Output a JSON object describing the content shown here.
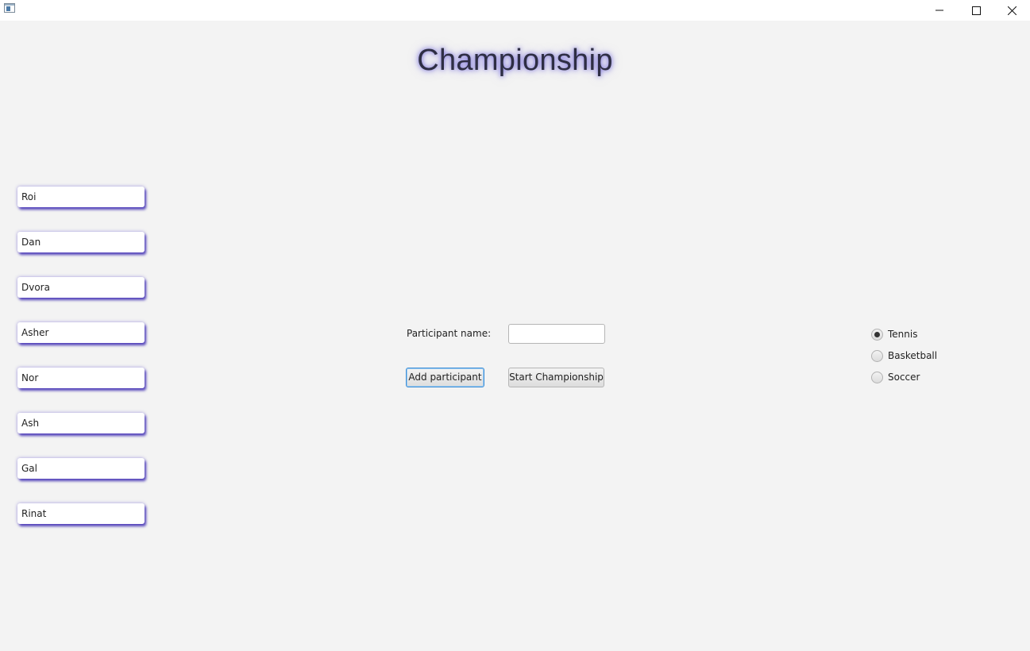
{
  "window": {
    "controls": {
      "minimize_icon": "minimize-icon",
      "maximize_icon": "maximize-icon",
      "close_icon": "close-icon"
    }
  },
  "title": "Championship",
  "participants": [
    "Roi",
    "Dan",
    "Dvora",
    "Asher",
    "Nor",
    "Ash",
    "Gal",
    "Rinat"
  ],
  "form": {
    "name_label": "Participant name:",
    "name_value": "",
    "add_button": "Add participant",
    "start_button": "Start Championship"
  },
  "sports": {
    "options": [
      "Tennis",
      "Basketball",
      "Soccer"
    ],
    "selected": "Tennis"
  },
  "colors": {
    "background": "#f3f3f3",
    "glow": "#5a50d2",
    "focus_border": "#3f8fd6"
  }
}
